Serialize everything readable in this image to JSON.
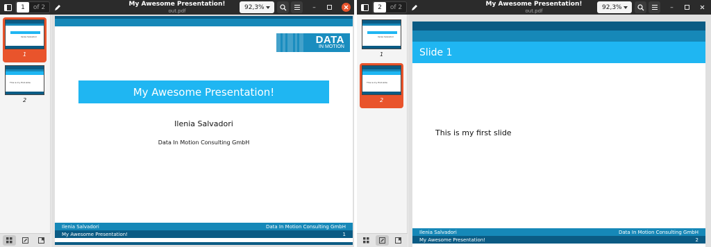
{
  "colors": {
    "titlebar": "#2b2b2b",
    "accent_orange": "#e9542c",
    "beamer_dark": "#0b5b84",
    "beamer_mid": "#1688b8",
    "beamer_light": "#1fb6f2"
  },
  "left_window": {
    "current_page": "1",
    "page_total": "of 2",
    "title": "My Awesome Presentation!",
    "subtitle": "out.pdf",
    "zoom": "92,3%",
    "thumbnails": [
      {
        "label": "1",
        "selected": true
      },
      {
        "label": "2",
        "selected": false
      }
    ]
  },
  "right_window": {
    "current_page": "2",
    "page_total": "of 2",
    "title": "My Awesome Presentation!",
    "subtitle": "out.pdf",
    "zoom": "92,3%",
    "thumbnails": [
      {
        "label": "1",
        "selected": false
      },
      {
        "label": "2",
        "selected": true
      }
    ]
  },
  "slide1": {
    "logo_main": "DATA",
    "logo_sub": "IN MOTION",
    "title": "My Awesome Presentation!",
    "author": "Ilenia Salvadori",
    "institute": "Data In Motion Consulting GmbH",
    "footer_author": "Ilenia Salvadori",
    "footer_institute": "Data In Motion Consulting GmbH",
    "footer_title": "My Awesome Presentation!",
    "page_number": "1"
  },
  "slide2": {
    "heading": "Slide 1",
    "body": "This is my first slide",
    "footer_author": "Ilenia Salvadori",
    "footer_institute": "Data In Motion Consulting GmbH",
    "footer_title": "My Awesome Presentation!",
    "page_number": "2"
  },
  "thumb_text": {
    "title_author": "Ilenia Salvadori",
    "slide2_body": "This is my first slide"
  }
}
